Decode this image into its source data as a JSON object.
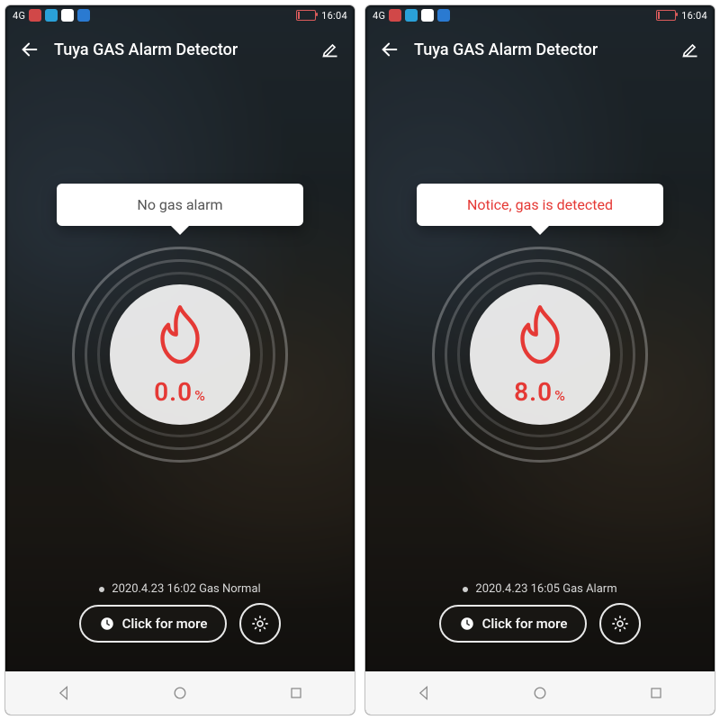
{
  "statusbar": {
    "network": "4G",
    "time": "16:04",
    "icons": [
      "nfc",
      "hotspot",
      "bt",
      "sim"
    ],
    "icon_bg": [
      "#d14848",
      "#2aa1d8",
      "#ffffff",
      "#2a7ad1"
    ]
  },
  "appbar": {
    "title": "Tuya GAS Alarm Detector"
  },
  "screens": [
    {
      "tooltip_text": "No gas alarm",
      "tooltip_class": "tt-normal",
      "percent": "0.0",
      "unit": "%",
      "status_text": "2020.4.23 16:02 Gas Normal",
      "more_label": "Click for more"
    },
    {
      "tooltip_text": "Notice, gas is detected",
      "tooltip_class": "tt-alarm",
      "percent": "8.0",
      "unit": "%",
      "status_text": "2020.4.23 16:05 Gas Alarm",
      "more_label": "Click for more"
    }
  ]
}
